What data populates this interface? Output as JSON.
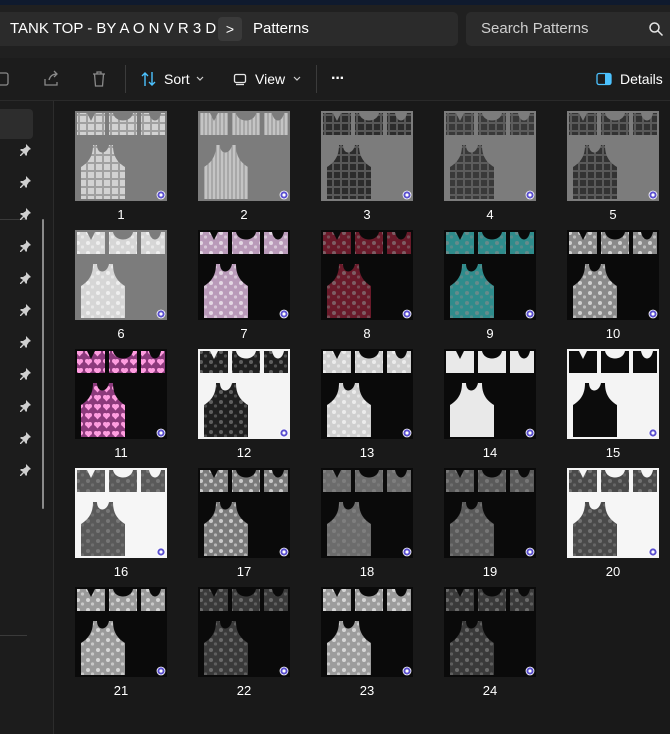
{
  "breadcrumb": {
    "folder": "TANK TOP - BY A O N V R 3 D",
    "current": "Patterns",
    "separator": ">"
  },
  "search": {
    "placeholder": "Search Patterns"
  },
  "toolbar": {
    "sort_label": "Sort",
    "view_label": "View",
    "more_label": "···",
    "details_label": "Details"
  },
  "colors": {
    "accent": "#4cc2ff",
    "badge": "#5a4fcf"
  },
  "thumbnails": [
    {
      "label": "1",
      "bg": "#7c7c7c",
      "fill": "#d2d2d2",
      "pattern": "plaid-light"
    },
    {
      "label": "2",
      "bg": "#7c7c7c",
      "fill": "#c4c4c4",
      "pattern": "stripes-light"
    },
    {
      "label": "3",
      "bg": "#7c7c7c",
      "fill": "#2c2c2c",
      "pattern": "plaid-dark"
    },
    {
      "label": "4",
      "bg": "#7c7c7c",
      "fill": "#393939",
      "pattern": "plaid-dark"
    },
    {
      "label": "5",
      "bg": "#7c7c7c",
      "fill": "#333333",
      "pattern": "gingham-dark"
    },
    {
      "label": "6",
      "bg": "#7c7c7c",
      "fill": "#d6d6d6",
      "pattern": "camo-light"
    },
    {
      "label": "7",
      "bg": "#0a0a0a",
      "fill": "#b99ab9",
      "pattern": "floral-lilac"
    },
    {
      "label": "8",
      "bg": "#0a0a0a",
      "fill": "#6a1a2a",
      "pattern": "floral-wine"
    },
    {
      "label": "9",
      "bg": "#0a0a0a",
      "fill": "#2e8c8c",
      "pattern": "floral-teal"
    },
    {
      "label": "10",
      "bg": "#0a0a0a",
      "fill": "#8a8a8a",
      "pattern": "floral-grey"
    },
    {
      "label": "11",
      "bg": "#0a0a0a",
      "fill": "#8c3a7c",
      "pattern": "hearts"
    },
    {
      "label": "12",
      "bg": "#f4f4f4",
      "fill": "#202020",
      "pattern": "swirl-dark"
    },
    {
      "label": "13",
      "bg": "#0a0a0a",
      "fill": "#cfcfcf",
      "pattern": "swirl-light"
    },
    {
      "label": "14",
      "bg": "#0a0a0a",
      "fill": "#e9e9e9",
      "pattern": "plain-white"
    },
    {
      "label": "15",
      "bg": "#f4f4f4",
      "fill": "#0c0c0c",
      "pattern": "plain-black"
    },
    {
      "label": "16",
      "bg": "#f6f6f6",
      "fill": "#5a5a5a",
      "pattern": "rose-grey"
    },
    {
      "label": "17",
      "bg": "#0a0a0a",
      "fill": "#7a7a7a",
      "pattern": "rose-grey"
    },
    {
      "label": "18",
      "bg": "#0a0a0a",
      "fill": "#6c6c6c",
      "pattern": "rose-grey"
    },
    {
      "label": "19",
      "bg": "#0a0a0a",
      "fill": "#5a5a5a",
      "pattern": "rose-dark"
    },
    {
      "label": "20",
      "bg": "#f6f6f6",
      "fill": "#4a4a4a",
      "pattern": "rose-grey"
    },
    {
      "label": "21",
      "bg": "#0a0a0a",
      "fill": "#9a9a9a",
      "pattern": "sparkle"
    },
    {
      "label": "22",
      "bg": "#0a0a0a",
      "fill": "#3a3a3a",
      "pattern": "sparkle-dark"
    },
    {
      "label": "23",
      "bg": "#0a0a0a",
      "fill": "#9c9c9c",
      "pattern": "lace"
    },
    {
      "label": "24",
      "bg": "#0a0a0a",
      "fill": "#3a3a3a",
      "pattern": "lace-dark"
    }
  ]
}
